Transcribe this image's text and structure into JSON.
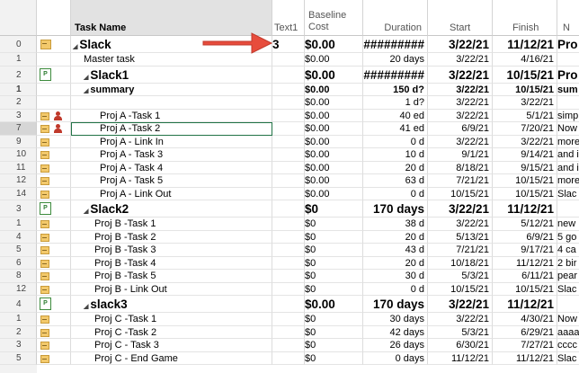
{
  "columns": {
    "name": "Task Name",
    "text1": "Text1",
    "cost": "Baseline\nCost",
    "duration": "Duration",
    "start": "Start",
    "finish": "Finish",
    "notes": "N"
  },
  "header_info_icon": "i",
  "rows": [
    {
      "id": "0",
      "ind": "note",
      "level": 0,
      "summary": true,
      "big": true,
      "name": "Slack",
      "text1": "3",
      "cost": "$0.00",
      "duration": "#########",
      "start": "3/22/21",
      "finish": "11/12/21",
      "notes": "Pro"
    },
    {
      "id": "1",
      "ind": "",
      "level": 1,
      "name": "Master task",
      "text1": "",
      "cost": "$0.00",
      "duration": "20 days",
      "start": "3/22/21",
      "finish": "4/16/21",
      "notes": ""
    },
    {
      "id": "2",
      "ind": "proj",
      "level": 1,
      "summary": true,
      "big": true,
      "name": "Slack1",
      "text1": "",
      "cost": "$0.00",
      "duration": "#########",
      "start": "3/22/21",
      "finish": "10/15/21",
      "notes": "Pro"
    },
    {
      "id": "1",
      "ind": "",
      "level": 2,
      "summary": true,
      "mid": true,
      "name": "summary",
      "text1": "",
      "cost": "$0.00",
      "duration": "150 d?",
      "start": "3/22/21",
      "finish": "10/15/21",
      "notes": "sum"
    },
    {
      "id": "2",
      "ind": "",
      "level": 3,
      "name": "",
      "text1": "",
      "cost": "$0.00",
      "duration": "1 d?",
      "start": "3/22/21",
      "finish": "3/22/21",
      "notes": ""
    },
    {
      "id": "3",
      "ind": "note",
      "res": true,
      "level": 3,
      "name": "Proj A -Task 1",
      "text1": "",
      "cost": "$0.00",
      "duration": "40 ed",
      "start": "3/22/21",
      "finish": "5/1/21",
      "notes": "simp"
    },
    {
      "id": "7",
      "ind": "note",
      "res": true,
      "level": 3,
      "sel": true,
      "name": "Proj A -Task 2",
      "text1": "",
      "cost": "$0.00",
      "duration": "41 ed",
      "start": "6/9/21",
      "finish": "7/20/21",
      "notes": "Now"
    },
    {
      "id": "9",
      "ind": "note",
      "level": 3,
      "name": "Proj A - Link In",
      "text1": "",
      "cost": "$0.00",
      "duration": "0 d",
      "start": "3/22/21",
      "finish": "3/22/21",
      "notes": "more"
    },
    {
      "id": "10",
      "ind": "note",
      "level": 3,
      "name": "Proj A - Task 3",
      "text1": "",
      "cost": "$0.00",
      "duration": "10 d",
      "start": "9/1/21",
      "finish": "9/14/21",
      "notes": "and i"
    },
    {
      "id": "11",
      "ind": "note",
      "level": 3,
      "name": "Proj A - Task 4",
      "text1": "",
      "cost": "$0.00",
      "duration": "20 d",
      "start": "8/18/21",
      "finish": "9/15/21",
      "notes": "and i"
    },
    {
      "id": "12",
      "ind": "note",
      "level": 3,
      "name": "Proj A - Task 5",
      "text1": "",
      "cost": "$0.00",
      "duration": "63 d",
      "start": "7/21/21",
      "finish": "10/15/21",
      "notes": "more"
    },
    {
      "id": "14",
      "ind": "note",
      "level": 3,
      "name": "Proj A - Link Out",
      "text1": "",
      "cost": "$0.00",
      "duration": "0 d",
      "start": "10/15/21",
      "finish": "10/15/21",
      "notes": "Slac"
    },
    {
      "id": "3",
      "ind": "proj",
      "level": 1,
      "summary": true,
      "big": true,
      "name": "Slack2",
      "text1": "",
      "cost": "$0",
      "duration": "170 days",
      "start": "3/22/21",
      "finish": "11/12/21",
      "notes": ""
    },
    {
      "id": "1",
      "ind": "note",
      "level": 2,
      "name": "Proj B -Task 1",
      "text1": "",
      "cost": "$0",
      "duration": "38 d",
      "start": "3/22/21",
      "finish": "5/12/21",
      "notes": "new"
    },
    {
      "id": "4",
      "ind": "note",
      "level": 2,
      "name": "Proj B -Task 2",
      "text1": "",
      "cost": "$0",
      "duration": "20 d",
      "start": "5/13/21",
      "finish": "6/9/21",
      "notes": "5 go"
    },
    {
      "id": "5",
      "ind": "note",
      "level": 2,
      "name": "Proj B -Task 3",
      "text1": "",
      "cost": "$0",
      "duration": "43 d",
      "start": "7/21/21",
      "finish": "9/17/21",
      "notes": "4 ca"
    },
    {
      "id": "6",
      "ind": "note",
      "level": 2,
      "name": "Proj B -Task 4",
      "text1": "",
      "cost": "$0",
      "duration": "20 d",
      "start": "10/18/21",
      "finish": "11/12/21",
      "notes": "2 bir"
    },
    {
      "id": "8",
      "ind": "note",
      "level": 2,
      "name": "Proj B -Task 5",
      "text1": "",
      "cost": "$0",
      "duration": "30 d",
      "start": "5/3/21",
      "finish": "6/11/21",
      "notes": "pear"
    },
    {
      "id": "12",
      "ind": "note",
      "level": 2,
      "name": "Proj B - Link Out",
      "text1": "",
      "cost": "$0",
      "duration": "0 d",
      "start": "10/15/21",
      "finish": "10/15/21",
      "notes": "Slac"
    },
    {
      "id": "4",
      "ind": "proj",
      "level": 1,
      "summary": true,
      "big": true,
      "name": "slack3",
      "text1": "",
      "cost": "$0.00",
      "duration": "170 days",
      "start": "3/22/21",
      "finish": "11/12/21",
      "notes": ""
    },
    {
      "id": "1",
      "ind": "note",
      "level": 2,
      "name": "Proj C -Task 1",
      "text1": "",
      "cost": "$0",
      "duration": "30 days",
      "start": "3/22/21",
      "finish": "4/30/21",
      "notes": "Now"
    },
    {
      "id": "2",
      "ind": "note",
      "level": 2,
      "name": "Proj C -Task 2",
      "text1": "",
      "cost": "$0",
      "duration": "42 days",
      "start": "5/3/21",
      "finish": "6/29/21",
      "notes": "aaaa"
    },
    {
      "id": "3",
      "ind": "note",
      "level": 2,
      "name": "Proj C - Task 3",
      "text1": "",
      "cost": "$0",
      "duration": "26 days",
      "start": "6/30/21",
      "finish": "7/27/21",
      "notes": "cccc"
    },
    {
      "id": "5",
      "ind": "note",
      "level": 2,
      "name": "Proj C - End Game",
      "text1": "",
      "cost": "$0",
      "duration": "0 days",
      "start": "11/12/21",
      "finish": "11/12/21",
      "notes": "Slac"
    }
  ]
}
